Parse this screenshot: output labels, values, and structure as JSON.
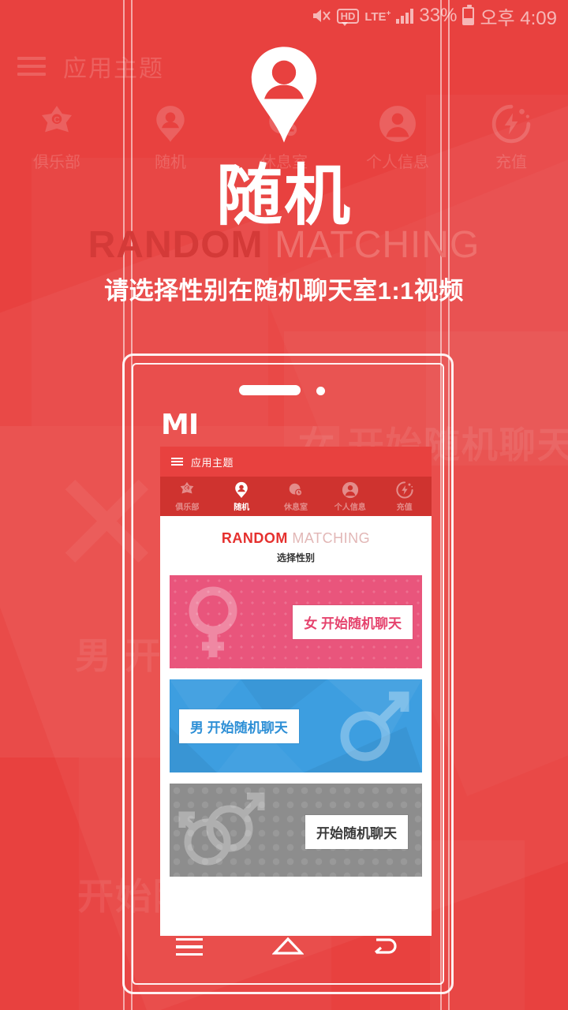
{
  "statusbar": {
    "mute_icon": "mute-icon",
    "hd_label": "HD",
    "network_label": "LTE",
    "network_sup": "+",
    "battery_percent": "33%",
    "clock": "오후 4:09"
  },
  "outer_header": {
    "menu_icon": "hamburger-icon",
    "app_title": "应用主题",
    "nav": [
      {
        "label": "俱乐部",
        "icon": "star-club-icon"
      },
      {
        "label": "随机",
        "icon": "pin-person-icon"
      },
      {
        "label": "休息室",
        "icon": "lounge-clock-icon"
      },
      {
        "label": "个人信息",
        "icon": "person-icon"
      },
      {
        "label": "充值",
        "icon": "bolt-charge-icon"
      }
    ]
  },
  "hero": {
    "center_icon": "pin-person-icon",
    "title": "随机",
    "brand_bold": "RANDOM",
    "brand_light": " MATCHING",
    "description": "请选择性别在随机聊天室1:1视频"
  },
  "background": {
    "watermark_a": "女 开始随机聊天",
    "watermark_b": "开始随机聊天",
    "watermark_c": "男 开始随机聊天",
    "x_mark": "✕"
  },
  "phone": {
    "brand_logo": "MI",
    "speaker": "speaker-slot",
    "camera": "front-camera",
    "screen": {
      "titlebar": {
        "menu_icon": "hamburger-icon",
        "app_title": "应用主题"
      },
      "nav": [
        {
          "label": "俱乐部",
          "icon": "star-club-icon",
          "active": false
        },
        {
          "label": "随机",
          "icon": "pin-person-icon",
          "active": true
        },
        {
          "label": "休息室",
          "icon": "lounge-clock-icon",
          "active": false
        },
        {
          "label": "个人信息",
          "icon": "person-icon",
          "active": false
        },
        {
          "label": "充值",
          "icon": "bolt-charge-icon",
          "active": false
        }
      ],
      "brand_bold": "RANDOM",
      "brand_light": " MATCHING",
      "select_label": "选择性别",
      "cards": [
        {
          "id": "female",
          "symbol": "female-symbol-icon",
          "button": "女 开始随机聊天",
          "color": "#e9557c"
        },
        {
          "id": "male",
          "symbol": "male-symbol-icon",
          "button": "男 开始随机聊天",
          "color": "#3d9ee0"
        },
        {
          "id": "other",
          "symbol": "double-male-symbol-icon",
          "button": "开始随机聊天",
          "color": "#8d8d8d"
        }
      ]
    },
    "softkeys": [
      {
        "name": "menu",
        "icon": "menu-icon"
      },
      {
        "name": "home",
        "icon": "home-icon"
      },
      {
        "name": "back",
        "icon": "back-arrow-icon"
      }
    ]
  },
  "colors": {
    "brand_red": "#e8413f",
    "dark_red": "#cf332f",
    "accent_red": "#e5302e",
    "female_pink": "#e9557c",
    "male_blue": "#3d9ee0",
    "other_gray": "#8d8d8d"
  }
}
